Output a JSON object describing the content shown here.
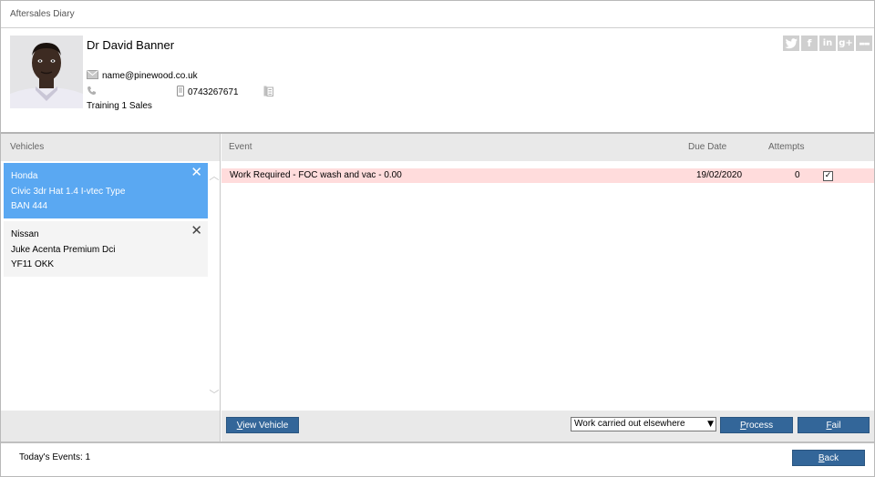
{
  "window": {
    "title": "Aftersales Diary"
  },
  "contact": {
    "name": "Dr David Banner",
    "email": "name@pinewood.co.uk",
    "phone": "",
    "mobile": "0743267671",
    "fax": "",
    "branch": "Training 1 Sales",
    "social": [
      "twitter-icon",
      "facebook-icon",
      "linkedin-icon",
      "googleplus-icon",
      "more-icon"
    ]
  },
  "vehicles": {
    "header": "Vehicles",
    "items": [
      {
        "make": "Honda",
        "model": "Civic 3dr Hat 1.4 I-vtec Type",
        "reg": "BAN 444",
        "selected": true
      },
      {
        "make": "Nissan",
        "model": "Juke Acenta Premium Dci",
        "reg": "YF11 OKK",
        "selected": false
      }
    ]
  },
  "events": {
    "columns": {
      "event": "Event",
      "due_date": "Due Date",
      "attempts": "Attempts"
    },
    "rows": [
      {
        "event": "Work Required - FOC wash and vac - 0.00",
        "due_date": "19/02/2020",
        "attempts": "0",
        "checked": true
      }
    ]
  },
  "actions": {
    "view_vehicle_pre": "",
    "view_vehicle_u": "V",
    "view_vehicle_post": "iew Vehicle",
    "outcome_value": "Work carried out elsewhere",
    "process_pre": "",
    "process_u": "P",
    "process_post": "rocess",
    "fail_pre": "",
    "fail_u": "F",
    "fail_post": "ail"
  },
  "footer": {
    "today_events": "Today's Events: 1",
    "back_pre": "",
    "back_u": "B",
    "back_post": "ack"
  },
  "colors": {
    "accent": "#336699",
    "selected": "#5aa8f2",
    "event_highlight": "#ffdcdc"
  }
}
